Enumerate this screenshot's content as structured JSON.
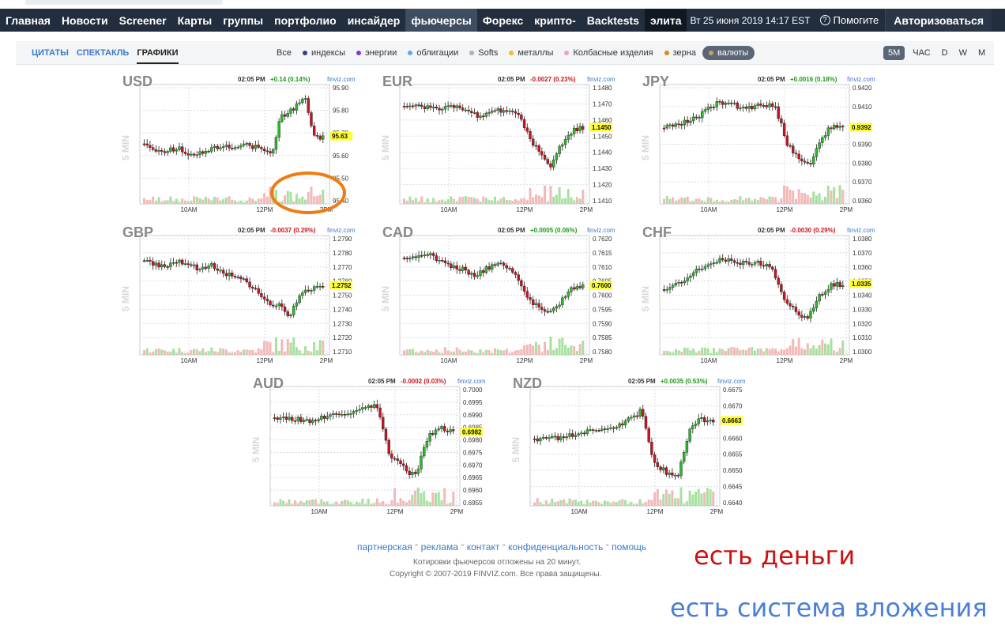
{
  "nav": {
    "items": [
      {
        "label": "Главная"
      },
      {
        "label": "Новости"
      },
      {
        "label": "Screener"
      },
      {
        "label": "Карты"
      },
      {
        "label": "группы"
      },
      {
        "label": "портфолио"
      },
      {
        "label": "инсайдер"
      },
      {
        "label": "фьючерсы",
        "active": true
      },
      {
        "label": "Форекс"
      },
      {
        "label": "крипто-"
      },
      {
        "label": "Backtests"
      },
      {
        "label": "элита",
        "elite": true
      }
    ],
    "date": "Вт 25 июня 2019 14:17 EST",
    "help": "Помогите",
    "login": "Авторизоваться"
  },
  "subnav": {
    "tabs": [
      {
        "label": "ЦИТАТЫ"
      },
      {
        "label": "СПЕКТАКЛЬ"
      },
      {
        "label": "ГРАФИКИ",
        "active": true
      }
    ],
    "filters": [
      {
        "label": "Все",
        "color": ""
      },
      {
        "label": "индексы",
        "color": "#2b3f8c"
      },
      {
        "label": "энергии",
        "color": "#7a3fc8"
      },
      {
        "label": "облигации",
        "color": "#5aa9f0"
      },
      {
        "label": "Softs",
        "color": "#b0b0b0"
      },
      {
        "label": "металлы",
        "color": "#f0c020"
      },
      {
        "label": "Колбасные изделия",
        "color": "#f0a0c8"
      },
      {
        "label": "зерна",
        "color": "#e08a18"
      },
      {
        "label": "валюты",
        "color": "#c8a060",
        "selected": true
      }
    ],
    "timeframes": [
      {
        "label": "5M",
        "selected": true
      },
      {
        "label": "ЧАС"
      },
      {
        "label": "D"
      },
      {
        "label": "W"
      },
      {
        "label": "M"
      }
    ]
  },
  "charts": [
    {
      "symbol": "USD",
      "time": "02:05 PM",
      "change": "+0.14 (0.14%)",
      "dir": "up",
      "source": "finviz.com",
      "side": "5 MIN",
      "yticks": [
        "95.90",
        "95.80",
        "95.70",
        "95.60",
        "95.50",
        "95.40"
      ],
      "last": "95.63",
      "xticks": [
        "10AM",
        "12PM",
        "2PM"
      ]
    },
    {
      "symbol": "EUR",
      "time": "02:05 PM",
      "change": "-0.0027 (0.23%)",
      "dir": "dn",
      "source": "finviz.com",
      "side": "5 MIN",
      "yticks": [
        "1.1480",
        "1.1470",
        "1.1460",
        "1.1450",
        "1.1440",
        "1.1430",
        "1.1420",
        "1.1410"
      ],
      "last": "1.1450",
      "xticks": [
        "10AM",
        "12PM",
        "2PM"
      ]
    },
    {
      "symbol": "JPY",
      "time": "02:05 PM",
      "change": "+0.0016 (0.18%)",
      "dir": "up",
      "source": "finviz.com",
      "side": "5 MIN",
      "yticks": [
        "0.9420",
        "0.9410",
        "0.9400",
        "0.9390",
        "0.9380",
        "0.9370",
        "0.9360"
      ],
      "last": "0.9392",
      "xticks": [
        "10AM",
        "12PM",
        "2PM"
      ]
    },
    {
      "symbol": "GBP",
      "time": "02:05 PM",
      "change": "-0.0037 (0.29%)",
      "dir": "dn",
      "source": "finviz.com",
      "side": "5 MIN",
      "yticks": [
        "1.2790",
        "1.2780",
        "1.2770",
        "1.2760",
        "1.2750",
        "1.2740",
        "1.2730",
        "1.2720",
        "1.2710"
      ],
      "last": "1.2752",
      "xticks": [
        "10AM",
        "12PM",
        "2PM"
      ]
    },
    {
      "symbol": "CAD",
      "time": "02:05 PM",
      "change": "+0.0005 (0.06%)",
      "dir": "up",
      "source": "finviz.com",
      "side": "5 MIN",
      "yticks": [
        "0.7620",
        "0.7615",
        "0.7610",
        "0.7605",
        "0.7600",
        "0.7595",
        "0.7590",
        "0.7585",
        "0.7580"
      ],
      "last": "0.7600",
      "xticks": [
        "10AM",
        "12PM",
        "2PM"
      ]
    },
    {
      "symbol": "CHF",
      "time": "02:05 PM",
      "change": "-0.0030 (0.29%)",
      "dir": "dn",
      "source": "finviz.com",
      "side": "5 MIN",
      "yticks": [
        "1.0380",
        "1.0370",
        "1.0360",
        "1.0350",
        "1.0340",
        "1.0330",
        "1.0320",
        "1.0310",
        "1.0300"
      ],
      "last": "1.0335",
      "xticks": [
        "10AM",
        "12PM",
        "2PM"
      ]
    },
    {
      "symbol": "AUD",
      "time": "02:05 PM",
      "change": "-0.0002 (0.03%)",
      "dir": "dn",
      "source": "finviz.com",
      "side": "5 MIN",
      "yticks": [
        "0.7000",
        "0.6995",
        "0.6990",
        "0.6985",
        "0.6980",
        "0.6975",
        "0.6970",
        "0.6965",
        "0.6960",
        "0.6955"
      ],
      "last": "0.6982",
      "xticks": [
        "10AM",
        "12PM",
        "2PM"
      ]
    },
    {
      "symbol": "NZD",
      "time": "02:05 PM",
      "change": "+0.0035 (0.53%)",
      "dir": "up",
      "source": "finviz.com",
      "side": "5 MIN",
      "yticks": [
        "0.6675",
        "0.6670",
        "0.6665",
        "0.6660",
        "0.6655",
        "0.6650",
        "0.6645",
        "0.6640"
      ],
      "last": "0.6663",
      "xticks": [
        "10AM",
        "12PM",
        "2PM"
      ]
    }
  ],
  "footer": {
    "links": [
      {
        "label": "партнерская"
      },
      {
        "label": "реклама"
      },
      {
        "label": "контакт"
      },
      {
        "label": "конфиденциальность"
      },
      {
        "label": "помощь"
      }
    ],
    "line1": "Котировки фьючерсов отложены на 20 минут.",
    "line2": "Copyright © 2007-2019 FINVIZ.com. Все права защищены."
  },
  "handwritten": {
    "line1": "есть деньги",
    "line2": "есть система вложения"
  },
  "colors": {
    "up": "#2db82d",
    "down": "#c8141e",
    "vol_up": "#a8e0a0",
    "vol_down": "#f4b8b8",
    "grid": "#d8dde2",
    "highlight": "#ffff33",
    "annotation": "#f07b10"
  }
}
